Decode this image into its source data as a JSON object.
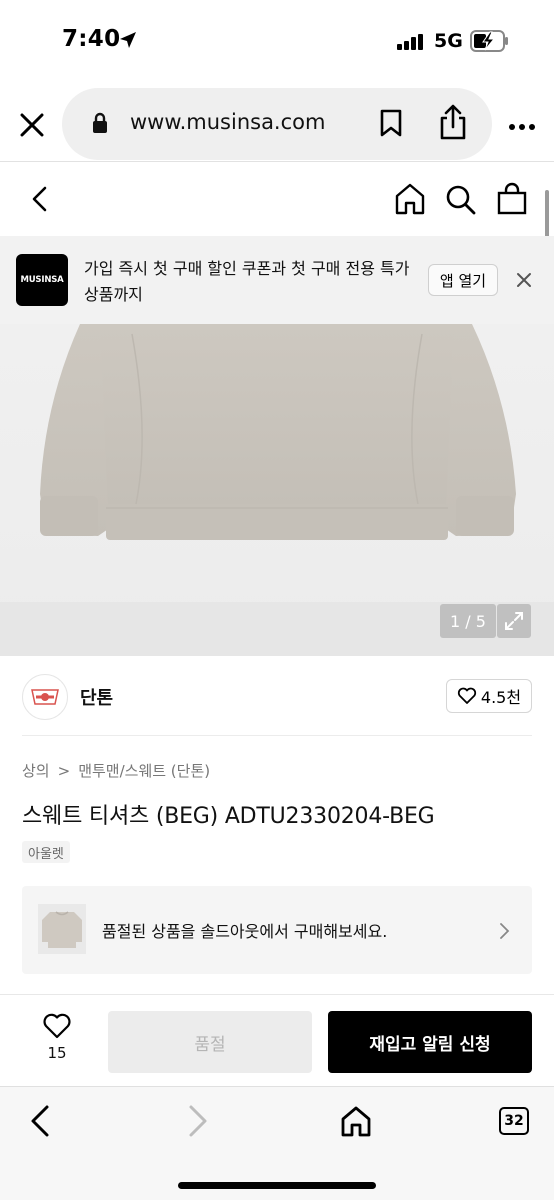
{
  "status_bar": {
    "time": "7:40",
    "network": "5G"
  },
  "browser": {
    "url": "www.musinsa.com",
    "tab_count": "32"
  },
  "app_banner": {
    "logo_text": "MUSINSA",
    "message": "가입 즉시 첫 구매 할인 쿠폰과 첫 구매 전용 특가 상품까지",
    "open_button": "앱 열기"
  },
  "product": {
    "image_counter": "1 / 5",
    "image_progress": {
      "current": 1,
      "total": 5
    },
    "brand": "단톤",
    "like_count": "4.5천",
    "breadcrumb": {
      "level1": "상의",
      "separator": ">",
      "level2": "맨투맨/스웨트 (단톤)"
    },
    "title": "스웨트 티셔츠 (BEG) ADTU2330204-BEG",
    "badge": "아울렛",
    "soldout_notice": "품절된 상품을 솔드아웃에서 구매해보세요."
  },
  "actions": {
    "wish_count": "15",
    "soldout_label": "품절",
    "restock_label": "재입고 알림 신청"
  },
  "colors": {
    "sweatshirt": "#c9c4bc",
    "accent_black": "#000000",
    "banner_bg": "#f2f2f2",
    "brand_red": "#d9534f"
  }
}
